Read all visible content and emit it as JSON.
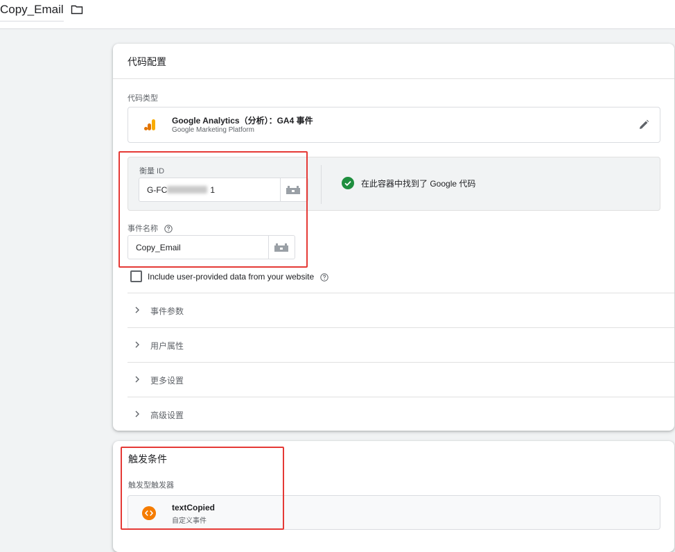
{
  "header": {
    "tag_name": "Copy_Email"
  },
  "tag_config": {
    "title": "代码配置",
    "tag_type_label": "代码类型",
    "tag_type_name": "Google Analytics（分析）：GA4 事件",
    "tag_type_platform": "Google Marketing Platform",
    "measurement_id_label": "衡量 ID",
    "measurement_id_prefix": "G-FC",
    "measurement_id_suffix": "1",
    "found_text": "在此容器中找到了 Google 代码",
    "event_name_label": "事件名称",
    "event_name_value": "Copy_Email",
    "checkbox_label": "Include user-provided data from your website",
    "sections": [
      "事件参数",
      "用户属性",
      "更多设置",
      "高级设置"
    ]
  },
  "triggering": {
    "title": "触发条件",
    "subtitle": "触发型触发器",
    "trigger_name": "textCopied",
    "trigger_type": "自定义事件"
  },
  "colors": {
    "accent_red": "#e53935",
    "check_green": "#1e8e3e",
    "ga_orange": "#f9ab00",
    "ga_dark_orange": "#e37400",
    "trigger_orange": "#f57c00"
  },
  "icons": [
    "folder-icon",
    "ga-analytics-icon",
    "edit-pencil-icon",
    "variable-icon",
    "check-circle-icon",
    "help-icon",
    "chevron-right-icon",
    "custom-event-icon"
  ]
}
